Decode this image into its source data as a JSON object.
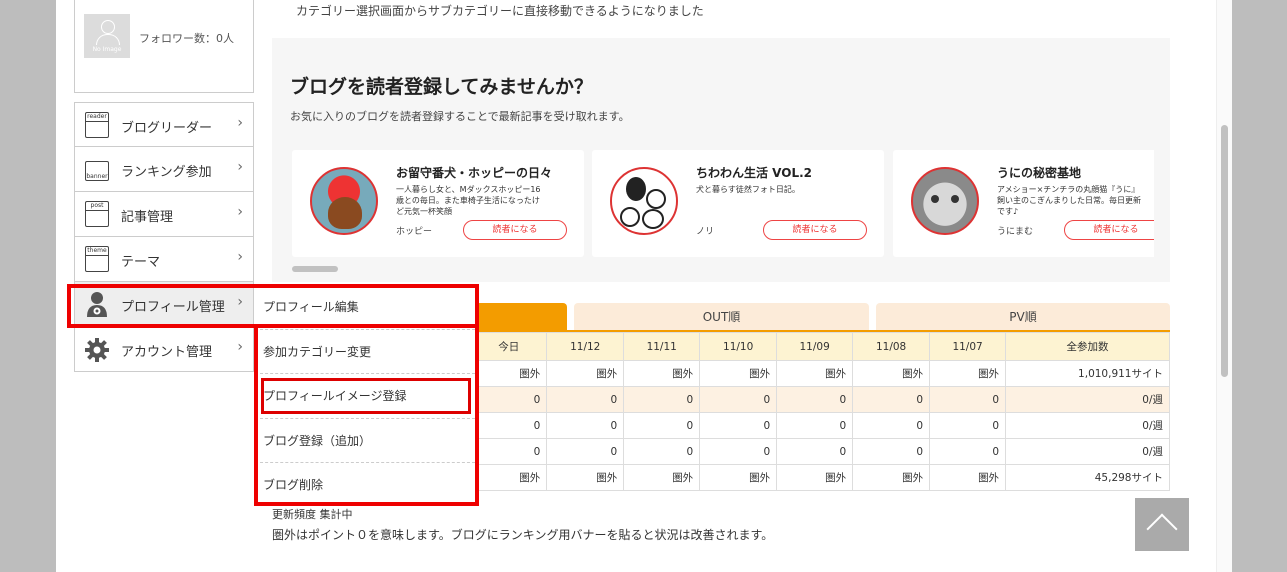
{
  "profile": {
    "followers": "フォロワー数：0人",
    "no_image": "No Image"
  },
  "notice": "カテゴリー選択画面からサブカテゴリーに直接移動できるようになりました",
  "menu": {
    "items": [
      {
        "label": "ブログリーダー",
        "icon": "reader-icon",
        "icon_text": "reader"
      },
      {
        "label": "ランキング参加",
        "icon": "banner-icon",
        "icon_text": "banner"
      },
      {
        "label": "記事管理",
        "icon": "post-icon",
        "icon_text": "post"
      },
      {
        "label": "テーマ",
        "icon": "theme-icon",
        "icon_text": "theme"
      },
      {
        "label": "プロフィール管理",
        "icon": "profile-icon"
      },
      {
        "label": "アカウント管理",
        "icon": "gear-icon"
      }
    ],
    "chevron": "›"
  },
  "submenu": {
    "items": [
      "プロフィール編集",
      "参加カテゴリー変更",
      "プロフィールイメージ登録",
      "ブログ登録（追加）",
      "ブログ削除"
    ]
  },
  "reco": {
    "title": "ブログを読者登録してみませんか？",
    "subtitle": "お気に入りのブログを読者登録することで最新記事を受け取れます。",
    "cards": [
      {
        "title": "お留守番犬・ホッピーの日々",
        "desc": "一人暮らし女と、Mダックスホッピー16歳との毎日。また車椅子生活になったけど元気一杯笑顔",
        "author": "ホッピー",
        "button": "読者になる"
      },
      {
        "title": "ちわわん生活 VOL.2",
        "desc": "犬と暮らす徒然フォト日記。",
        "author": "ノリ",
        "button": "読者になる"
      },
      {
        "title": "うにの秘密基地",
        "desc": "アメショー×チンチラの丸顔猫『うに』飼い主のこぎんまりした日常。毎日更新です♪",
        "author": "うにまむ",
        "button": "読者になる"
      }
    ]
  },
  "ranking": {
    "tabs": [
      "",
      "OUT順",
      "PV順"
    ],
    "header": [
      "今日",
      "11/12",
      "11/11",
      "11/10",
      "11/09",
      "11/08",
      "11/07",
      "全参加数"
    ],
    "rows": [
      [
        "圏外",
        "圏外",
        "圏外",
        "圏外",
        "圏外",
        "圏外",
        "圏外",
        "1,010,911サイト"
      ],
      [
        "0",
        "0",
        "0",
        "0",
        "0",
        "0",
        "0",
        "0/週"
      ],
      [
        "0",
        "0",
        "0",
        "0",
        "0",
        "0",
        "0",
        "0/週"
      ],
      [
        "0",
        "0",
        "0",
        "0",
        "0",
        "0",
        "0",
        "0/週"
      ],
      [
        "圏外",
        "圏外",
        "圏外",
        "圏外",
        "圏外",
        "圏外",
        "圏外",
        "45,298サイト"
      ]
    ],
    "footer1": "更新頻度 集計中",
    "footer2": "圏外はポイント０を意味します。ブログにランキング用バナーを貼ると状況は改善されます。"
  },
  "colors": {
    "accent": "#f39c00",
    "highlight": "#e00000"
  }
}
